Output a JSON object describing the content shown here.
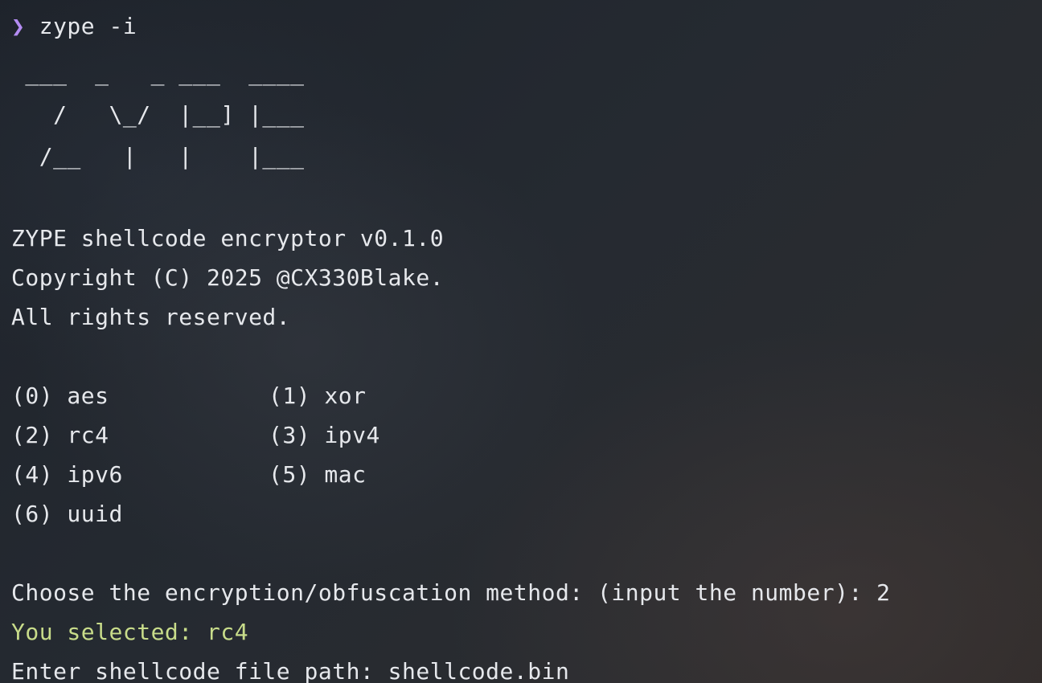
{
  "prompt": {
    "symbol": "❯",
    "command": "zype -i"
  },
  "banner": {
    "lines": [
      " ___  _   _ ___  ____",
      "   /   \\_/  |__] |___",
      "  /__   |   |    |___"
    ]
  },
  "info": {
    "title": "ZYPE shellcode encryptor v0.1.0",
    "copyright": "Copyright (C) 2025 @CX330Blake.",
    "rights": "All rights reserved."
  },
  "menu": {
    "rows": [
      [
        {
          "label": "(0) aes"
        },
        {
          "label": "(1) xor"
        }
      ],
      [
        {
          "label": "(2) rc4"
        },
        {
          "label": "(3) ipv4"
        }
      ],
      [
        {
          "label": "(4) ipv6"
        },
        {
          "label": "(5) mac"
        }
      ],
      [
        {
          "label": "(6) uuid"
        }
      ]
    ]
  },
  "interaction": {
    "choose_prompt": "Choose the encryption/obfuscation method: (input the number): 2",
    "selected": "You selected: rc4",
    "path_prompt": "Enter shellcode file path: shellcode.bin"
  },
  "colors": {
    "prompt_symbol": "#b48cf2",
    "selected_text": "#c8dc8a",
    "foreground": "#e6e8ec"
  }
}
